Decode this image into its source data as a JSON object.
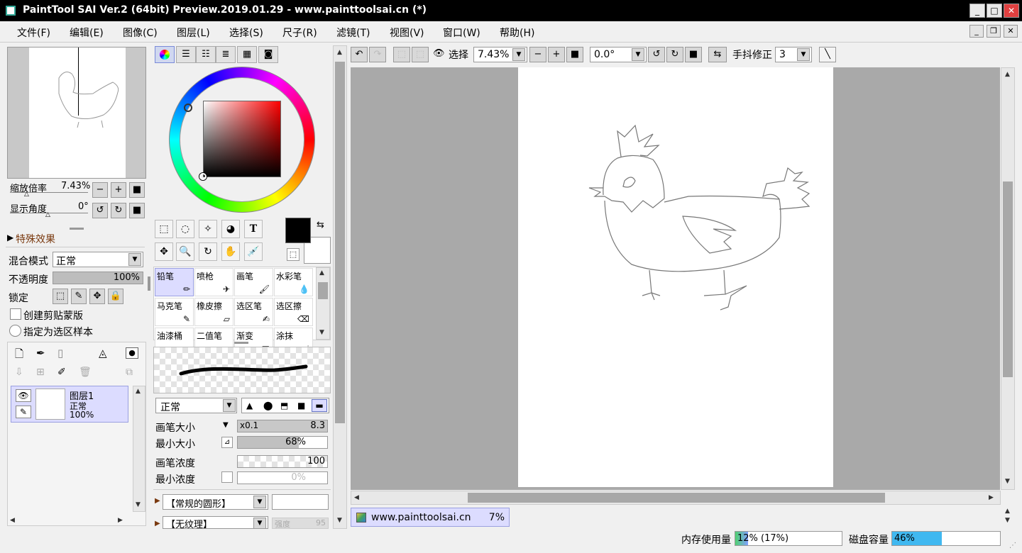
{
  "window": {
    "title": "PaintTool SAI Ver.2 (64bit) Preview.2019.01.29 - www.painttoolsai.cn (*)"
  },
  "menu": [
    "文件(F)",
    "编辑(E)",
    "图像(C)",
    "图层(L)",
    "选择(S)",
    "尺子(R)",
    "滤镜(T)",
    "视图(V)",
    "窗口(W)",
    "帮助(H)"
  ],
  "navigator": {
    "zoom_label": "缩放倍率",
    "zoom_value": "7.43%",
    "angle_label": "显示角度",
    "angle_value": "0°"
  },
  "effects": {
    "title": "特殊效果"
  },
  "layer_props": {
    "blend_label": "混合模式",
    "blend_value": "正常",
    "opacity_label": "不透明度",
    "opacity_value": "100%",
    "opacity_fraction": 1.0,
    "lock_label": "锁定",
    "clip_label": "创建剪贴蒙版",
    "sample_label": "指定为选区样本"
  },
  "layers": [
    {
      "name": "图层1",
      "mode": "正常",
      "opacity": "100%"
    }
  ],
  "brushes": [
    {
      "name": "铅笔",
      "icon": "pencil-icon",
      "selected": true
    },
    {
      "name": "喷枪",
      "icon": "airbrush-icon"
    },
    {
      "name": "画笔",
      "icon": "brush-icon"
    },
    {
      "name": "水彩笔",
      "icon": "watercolor-icon"
    },
    {
      "name": "马克笔",
      "icon": "marker-icon"
    },
    {
      "name": "橡皮擦",
      "icon": "eraser-icon"
    },
    {
      "name": "选区笔",
      "icon": "select-pen-icon"
    },
    {
      "name": "选区擦",
      "icon": "select-eraser-icon"
    },
    {
      "name": "油漆桶",
      "icon": "bucket-icon"
    },
    {
      "name": "二值笔",
      "icon": "binary-pen-icon"
    },
    {
      "name": "渐变",
      "icon": "gradient-icon"
    },
    {
      "name": "涂抹",
      "icon": "smudge-icon"
    }
  ],
  "brush_settings": {
    "mode_value": "正常",
    "size_label": "画笔大小",
    "size_multiplier": "x0.1",
    "size_value": "8.3",
    "min_size_label": "最小大小",
    "min_size_value": "68%",
    "min_size_fraction": 0.68,
    "density_label": "画笔浓度",
    "density_value": "100",
    "min_density_label": "最小浓度",
    "min_density_value": "0%",
    "shape_value": "【常规的圆形】",
    "texture_value": "【无纹理】",
    "texture_strength_label": "强度",
    "texture_strength_value": "95"
  },
  "toolbar": {
    "select_label": "选择",
    "zoom_value": "7.43%",
    "angle_value": "0.0°",
    "stabilizer_label": "手抖修正",
    "stabilizer_value": "3"
  },
  "document_tab": {
    "name": "www.painttoolsai.cn",
    "zoom": "7%"
  },
  "status": {
    "memory_label": "内存使用量",
    "memory_value": "12% (17%)",
    "memory_fraction": 0.12,
    "disk_label": "磁盘容量",
    "disk_value": "46%",
    "disk_fraction": 0.46
  },
  "colors": {
    "accent": "#3399ff",
    "selection": "#dcdcff",
    "current_color": "#000000"
  }
}
